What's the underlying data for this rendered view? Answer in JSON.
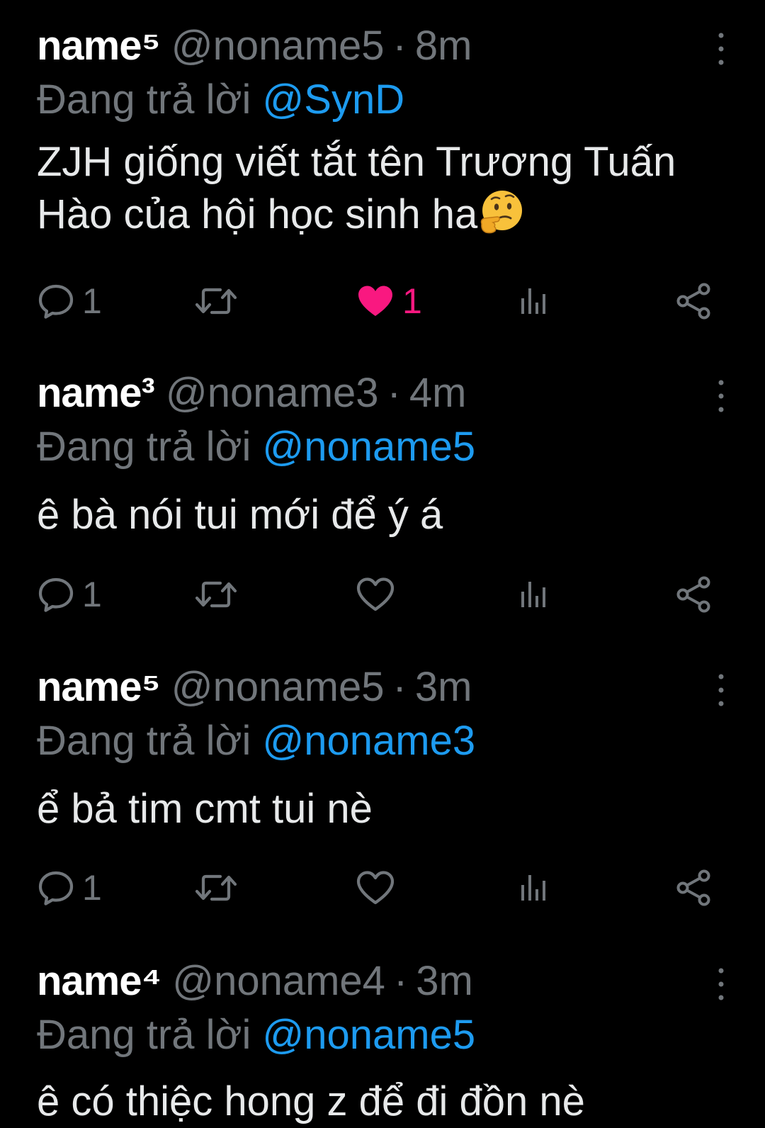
{
  "colors": {
    "background": "#000000",
    "text": "#e7e9ea",
    "muted": "#71767b",
    "link": "#1d9bf0",
    "like": "#f91880"
  },
  "icons": {
    "reply": "chat-bubble-icon",
    "retweet": "retweet-icon",
    "like": "heart-icon",
    "views": "bar-chart-icon",
    "share": "share-icon",
    "more": "vertical-dots-icon"
  },
  "tweets": [
    {
      "name": "name⁵",
      "handle": "@noname5",
      "separator": "·",
      "time": "8m",
      "reply_prefix": "Đang trả lời",
      "reply_to": "@SynD",
      "text": "ZJH giống viết tắt tên Trương Tuấn Hào của hội học sinh ha",
      "emoji": "thinking-face",
      "reply_count": "1",
      "like_count": "1",
      "liked": true
    },
    {
      "name": "name³",
      "handle": "@noname3",
      "separator": "·",
      "time": "4m",
      "reply_prefix": "Đang trả lời",
      "reply_to": "@noname5",
      "text": "ê bà nói tui mới để ý á",
      "reply_count": "1",
      "like_count": "",
      "liked": false
    },
    {
      "name": "name⁵",
      "handle": "@noname5",
      "separator": "·",
      "time": "3m",
      "reply_prefix": "Đang trả lời",
      "reply_to": "@noname3",
      "text": "ể bả tim cmt tui nè",
      "reply_count": "1",
      "like_count": "",
      "liked": false
    },
    {
      "name": "name⁴",
      "handle": "@noname4",
      "separator": "·",
      "time": "3m",
      "reply_prefix": "Đang trả lời",
      "reply_to": "@noname5",
      "text": "ê có thiệc hong z để đi đồn nè",
      "reply_count": "",
      "like_count": "",
      "liked": false
    }
  ]
}
